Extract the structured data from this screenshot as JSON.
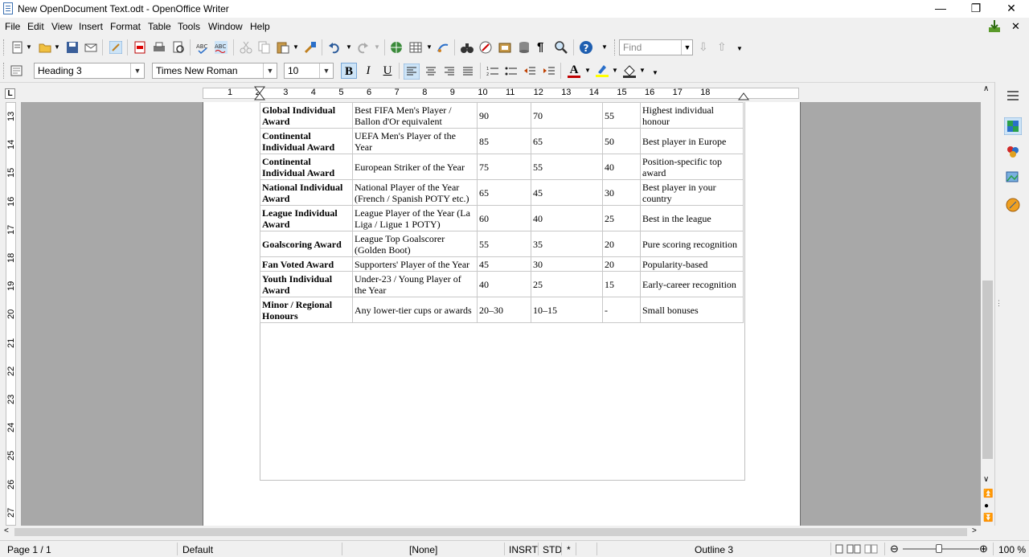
{
  "window": {
    "title": "New OpenDocument Text.odt - OpenOffice Writer",
    "minimize": "—",
    "restore": "❐",
    "close": "✕"
  },
  "menu": [
    "File",
    "Edit",
    "View",
    "Insert",
    "Format",
    "Table",
    "Tools",
    "Window",
    "Help"
  ],
  "toolbar": {
    "find_placeholder": "Find",
    "paragraph_style": "Heading 3",
    "font_name": "Times New Roman",
    "font_size": "10",
    "bold": "B",
    "italic": "I",
    "underline": "U",
    "font_color_letter": "A"
  },
  "ruler": {
    "h_labels": [
      "1",
      "2",
      "3",
      "4",
      "5",
      "6",
      "7",
      "8",
      "9",
      "10",
      "11",
      "12",
      "13",
      "14",
      "15",
      "16",
      "17",
      "18"
    ],
    "v_labels": [
      "13",
      "14",
      "15",
      "16",
      "17",
      "18",
      "19",
      "20",
      "21",
      "22",
      "23",
      "24",
      "25",
      "26",
      "27"
    ]
  },
  "table": {
    "rows": [
      [
        "Global Individual Award",
        "Best FIFA Men's Player / Ballon d'Or equivalent",
        "90",
        "70",
        "55",
        "Highest individual honour"
      ],
      [
        "Continental Individual Award",
        "UEFA Men's Player of the Year",
        "85",
        "65",
        "50",
        "Best player in Europe"
      ],
      [
        "Continental Individual Award",
        "European Striker of the Year",
        "75",
        "55",
        "40",
        "Position-specific top award"
      ],
      [
        "National Individual Award",
        "National Player of the Year (French / Spanish POTY etc.)",
        "65",
        "45",
        "30",
        "Best player in your country"
      ],
      [
        "League Individual Award",
        "League Player of the Year (La Liga / Ligue 1 POTY)",
        "60",
        "40",
        "25",
        "Best in the league"
      ],
      [
        "Goalscoring Award",
        "League Top Goalscorer (Golden Boot)",
        "55",
        "35",
        "20",
        "Pure scoring recognition"
      ],
      [
        "Fan Voted Award",
        "Supporters' Player of the Year",
        "45",
        "30",
        "20",
        "Popularity-based"
      ],
      [
        "Youth Individual Award",
        "Under-23 / Young Player of the Year",
        "40",
        "25",
        "15",
        "Early-career recognition"
      ],
      [
        "Minor / Regional Honours",
        "Any lower-tier cups or awards",
        "20–30",
        "10–15",
        "-",
        "Small bonuses"
      ]
    ]
  },
  "status": {
    "page": "Page 1 / 1",
    "page_style": "Default",
    "language": "[None]",
    "insert_mode": "INSRT",
    "selection_mode": "STD",
    "modified": "*",
    "outline": "Outline 3",
    "zoom": "100 %"
  },
  "colors": {
    "font_color": "#c00000",
    "highlight": "#ffff00",
    "accent": "#2a6fc9"
  }
}
